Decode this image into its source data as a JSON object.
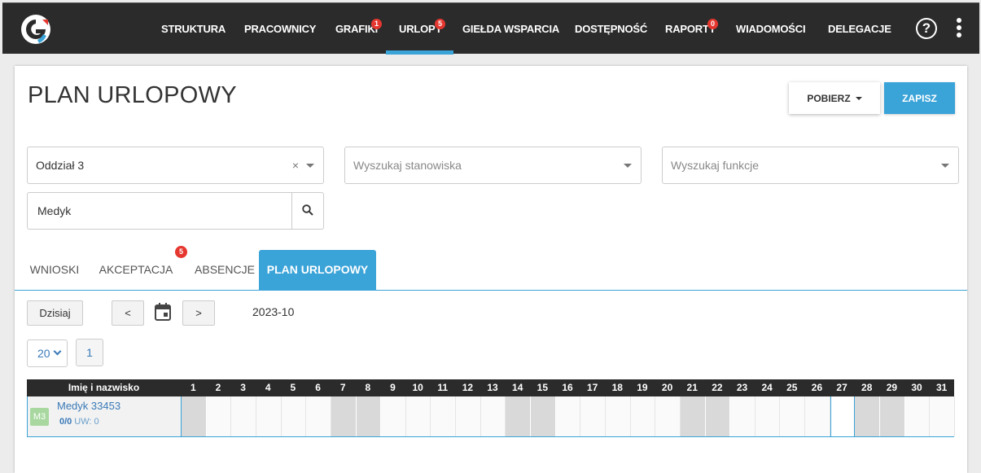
{
  "nav": {
    "items": [
      {
        "label": "STRUKTURA",
        "badge": ""
      },
      {
        "label": "PRACOWNICY",
        "badge": ""
      },
      {
        "label": "GRAFIKI",
        "badge": "1"
      },
      {
        "label": "URLOPY",
        "badge": "5",
        "active": true
      },
      {
        "label": "GIEŁDA WSPARCIA",
        "badge": ""
      },
      {
        "label": "DOSTĘPNOŚĆ",
        "badge": ""
      },
      {
        "label": "RAPORTY",
        "badge": "0"
      },
      {
        "label": "WIADOMOŚCI",
        "badge": ""
      },
      {
        "label": "DELEGACJE",
        "badge": ""
      }
    ],
    "help_label": "?"
  },
  "page": {
    "title": "PLAN URLOPOWY",
    "download_label": "POBIERZ",
    "save_label": "ZAPISZ"
  },
  "filters": {
    "department_value": "Oddział 3",
    "clear_symbol": "×",
    "position_placeholder": "Wyszukaj stanowiska",
    "function_placeholder": "Wyszukaj funkcje",
    "search_value": "Medyk"
  },
  "tabs": [
    {
      "label": "WNIOSKI",
      "badge": ""
    },
    {
      "label": "AKCEPTACJA",
      "badge": "5"
    },
    {
      "label": "ABSENCJE",
      "badge": ""
    },
    {
      "label": "PLAN URLOPOWY",
      "badge": "",
      "active": true
    }
  ],
  "calendar": {
    "today_label": "Dzisiaj",
    "prev_label": "<",
    "next_label": ">",
    "month": "2023-10"
  },
  "pagination": {
    "page_size": "20",
    "current_page": "1"
  },
  "grid": {
    "name_header": "Imię i nazwisko",
    "days": [
      "1",
      "2",
      "3",
      "4",
      "5",
      "6",
      "7",
      "8",
      "9",
      "10",
      "11",
      "12",
      "13",
      "14",
      "15",
      "16",
      "17",
      "18",
      "19",
      "20",
      "21",
      "22",
      "23",
      "24",
      "25",
      "26",
      "27",
      "28",
      "29",
      "30",
      "31"
    ],
    "weekend_days": [
      1,
      7,
      8,
      14,
      15,
      21,
      22,
      28,
      29
    ],
    "holiday_days": [
      27
    ],
    "rows": [
      {
        "avatar": "M3",
        "name": "Medyk 33453",
        "stats": "0/0",
        "uw": "UW: 0"
      }
    ]
  },
  "colors": {
    "accent": "#3aa3d8",
    "nav_bg": "#2b2b2b",
    "badge": "#e5372f",
    "link": "#3a7ab8"
  }
}
